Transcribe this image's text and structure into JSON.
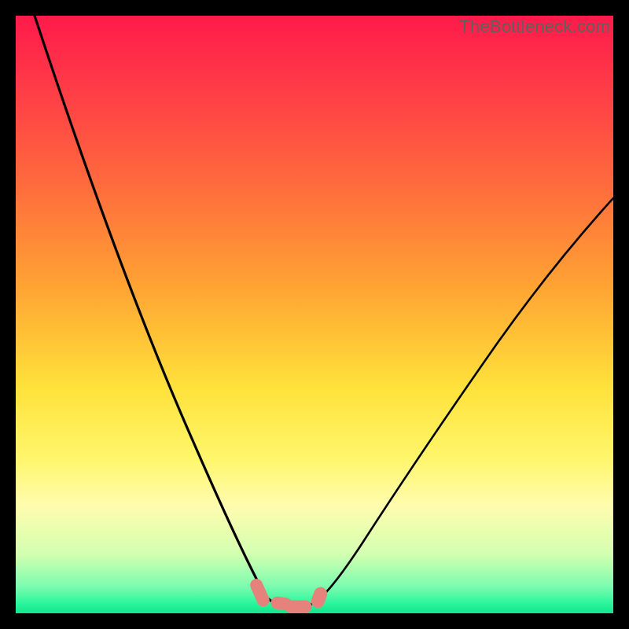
{
  "watermark": "TheBottleneck.com",
  "chart_data": {
    "type": "line",
    "title": "",
    "xlabel": "",
    "ylabel": "",
    "xlim": [
      0,
      100
    ],
    "ylim": [
      0,
      100
    ],
    "grid": false,
    "background": {
      "type": "vertical-gradient",
      "stops": [
        {
          "pos": 0.0,
          "color": "#ff1a4b"
        },
        {
          "pos": 0.12,
          "color": "#ff3b47"
        },
        {
          "pos": 0.28,
          "color": "#ff6a3d"
        },
        {
          "pos": 0.45,
          "color": "#ffa233"
        },
        {
          "pos": 0.62,
          "color": "#ffe13a"
        },
        {
          "pos": 0.74,
          "color": "#fff66b"
        },
        {
          "pos": 0.82,
          "color": "#fffcae"
        },
        {
          "pos": 0.9,
          "color": "#d4ffb0"
        },
        {
          "pos": 0.955,
          "color": "#7dfcb0"
        },
        {
          "pos": 0.985,
          "color": "#27f59b"
        },
        {
          "pos": 1.0,
          "color": "#11e68e"
        }
      ]
    },
    "series": [
      {
        "name": "bottleneck-curve",
        "color": "#000000",
        "x": [
          3,
          6,
          9,
          12,
          15,
          18,
          21,
          24,
          27,
          30,
          33,
          36,
          38,
          40,
          42,
          44,
          46,
          48,
          50,
          55,
          60,
          65,
          70,
          75,
          80,
          85,
          90,
          95,
          100
        ],
        "y": [
          100,
          92,
          84,
          77,
          70,
          63,
          56,
          49,
          42,
          35,
          28,
          21,
          15,
          10,
          6,
          3,
          1.6,
          1.2,
          1.3,
          2.2,
          5,
          10,
          18,
          27,
          37,
          47,
          56,
          63,
          69
        ]
      }
    ],
    "markers": [
      {
        "name": "sweet-spot-range",
        "shape": "pill-cluster",
        "color": "#e4827b",
        "x_range": [
          40,
          50
        ],
        "y": 1.5
      }
    ]
  }
}
